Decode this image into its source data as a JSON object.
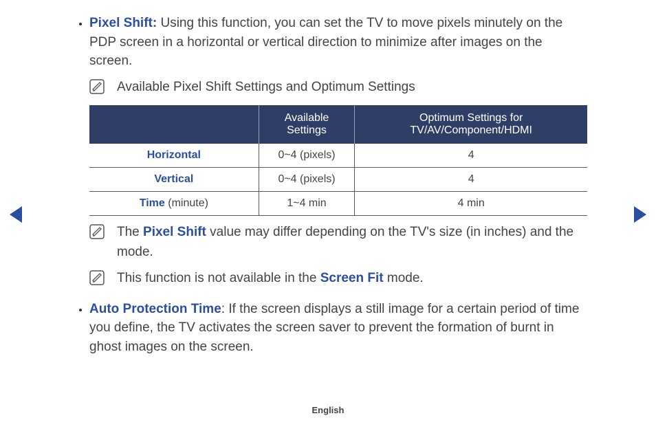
{
  "bullets": {
    "pixel_shift": {
      "term": "Pixel Shift:",
      "desc": " Using this function, you can set the TV to move pixels minutely on the PDP screen in a horizontal or vertical direction to minimize after images on the screen.",
      "note_intro": "Available Pixel Shift Settings and Optimum Settings",
      "table": {
        "headers": [
          "",
          "Available Settings",
          "Optimum Settings for TV/AV/Component/HDMI"
        ],
        "rows": [
          {
            "label": "Horizontal",
            "suffix": "",
            "avail": "0~4 (pixels)",
            "opt": "4"
          },
          {
            "label": "Vertical",
            "suffix": "",
            "avail": "0~4 (pixels)",
            "opt": "4"
          },
          {
            "label": "Time",
            "suffix": " (minute)",
            "avail": "1~4 min",
            "opt": "4 min"
          }
        ]
      },
      "note2_pre": "The ",
      "note2_link": "Pixel Shift",
      "note2_post": " value may differ depending on the TV's size (in inches) and the mode.",
      "note3_pre": "This function is not available in the ",
      "note3_link": "Screen Fit",
      "note3_post": " mode."
    },
    "auto_prot": {
      "term": "Auto Protection Time",
      "desc": ": If the screen displays a still image for a certain period of time you define, the TV activates the screen saver to prevent the formation of burnt in ghost images on the screen."
    }
  },
  "footer": "English"
}
